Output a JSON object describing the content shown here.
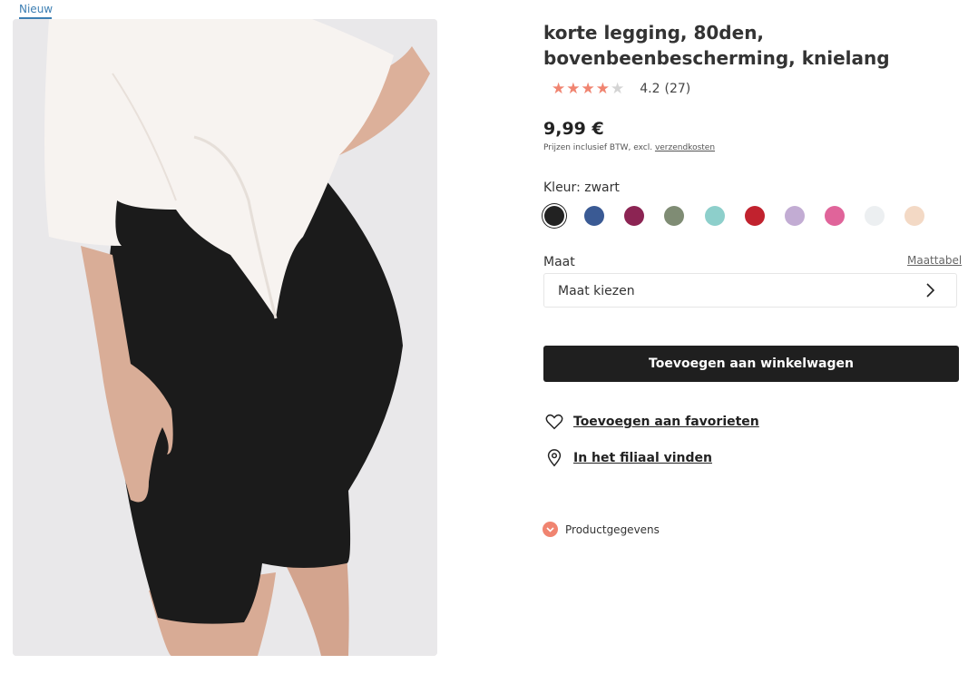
{
  "badge": {
    "label": "Nieuw"
  },
  "product": {
    "title": "korte legging, 80den, bovenbeenbescherming, knielang",
    "rating": {
      "stars": "★★★★",
      "empty_star": "★",
      "value": "4.2",
      "count": "(27)"
    },
    "price": "9,99 €",
    "price_note": "Prijzen inclusief BTW, excl.",
    "shipping_link": "verzendkosten"
  },
  "color": {
    "label": "Kleur: zwart",
    "swatches": [
      "#222222",
      "#3a5a94",
      "#8c2453",
      "#7f8c74",
      "#8dcfcb",
      "#c1222e",
      "#c2acd3",
      "#e0649a",
      "#eceff1",
      "#f3d9c5"
    ]
  },
  "size": {
    "label": "Maat",
    "table_link": "Maattabel",
    "select_placeholder": "Maat kiezen"
  },
  "actions": {
    "add_to_cart": "Toevoegen aan winkelwagen",
    "favorites": "Toevoegen aan favorieten",
    "find_store": "In het filiaal vinden"
  },
  "details": {
    "label": "Productgegevens"
  }
}
